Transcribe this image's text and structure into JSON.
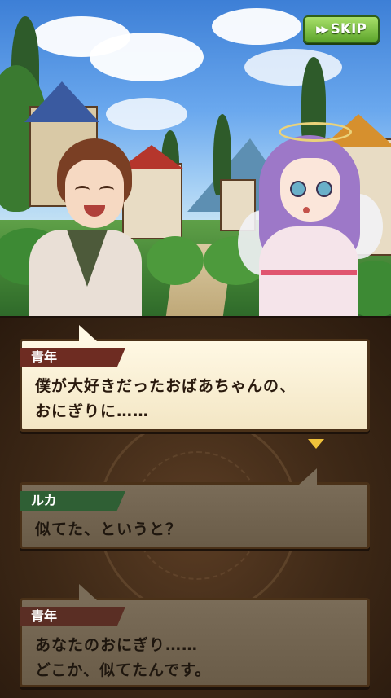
{
  "skip_button": {
    "label": "SKIP",
    "icon": "fast-forward-icon"
  },
  "dialogue_log": [
    {
      "speaker": "青年",
      "line1": "僕が大好きだったおばあちゃんの、",
      "line2": "おにぎりに……",
      "state": "current"
    },
    {
      "speaker": "ルカ",
      "line1": "似てた、というと？",
      "line2": "",
      "state": "past"
    },
    {
      "speaker": "青年",
      "line1": "あなたのおにぎり……",
      "line2": "どこか、似てたんです。",
      "state": "past"
    }
  ],
  "next_indicator": {
    "icon": "next-triangle-icon"
  },
  "colors": {
    "skip_green": "#5ea52c",
    "name_red": "#6e2c22",
    "name_green": "#2f5f34",
    "next_gold": "#f0c23a"
  }
}
